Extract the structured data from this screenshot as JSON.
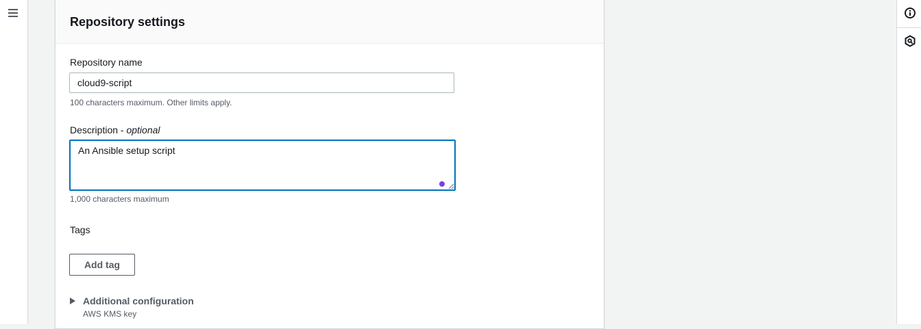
{
  "panel": {
    "title": "Repository settings"
  },
  "repo_name": {
    "label": "Repository name",
    "value": "cloud9-script",
    "hint": "100 characters maximum. Other limits apply."
  },
  "description": {
    "label": "Description - ",
    "optional": "optional",
    "value": "An Ansible setup script",
    "hint": "1,000 characters maximum"
  },
  "tags": {
    "label": "Tags",
    "add_button": "Add tag"
  },
  "additional": {
    "label": "Additional configuration",
    "sub": "AWS KMS key"
  },
  "icons": {
    "menu": "hamburger-menu-icon",
    "info": "info-icon",
    "help": "help-panel-icon"
  },
  "colors": {
    "focus": "#0073bb",
    "grammarly": "#7b3fe4",
    "text": "#16191f",
    "muted": "#545b64"
  }
}
